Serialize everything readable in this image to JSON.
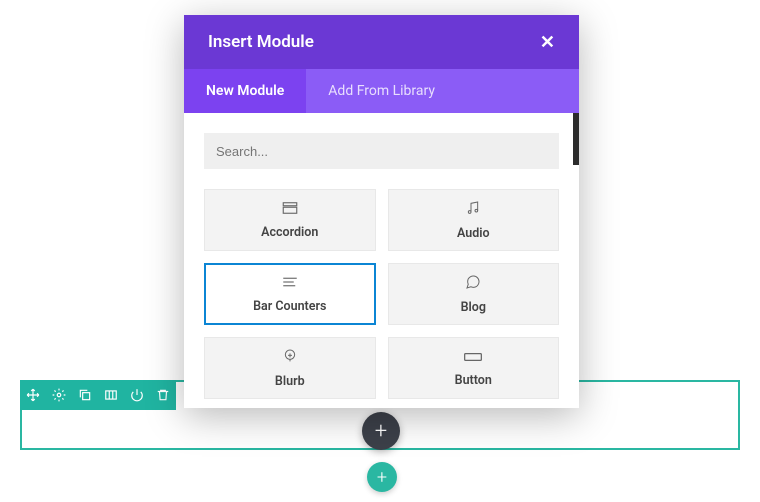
{
  "modal": {
    "title": "Insert Module",
    "tabs": {
      "new": "New Module",
      "library": "Add From Library"
    },
    "search_placeholder": "Search...",
    "modules": {
      "accordion": "Accordion",
      "audio": "Audio",
      "bar_counters": "Bar Counters",
      "blog": "Blog",
      "blurb": "Blurb",
      "button": "Button"
    }
  },
  "section": {
    "add_module_plus": "+",
    "add_section_plus": "+"
  }
}
